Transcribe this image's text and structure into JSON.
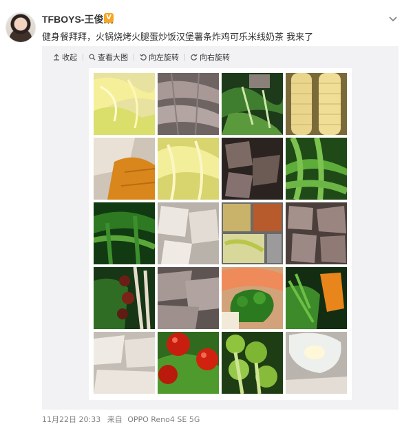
{
  "post": {
    "username": "TFBOYS-王俊凯",
    "verified_badge": "V",
    "text": "健身餐拜拜，火锅烧烤火腿蛋炒饭汉堡薯条炸鸡可乐米线奶茶 我来了",
    "timestamp": "11月22日 20:33",
    "source_prefix": "来自",
    "source_device": "OPPO Reno4 SE 5G"
  },
  "toolbar": {
    "collapse_label": "收起",
    "view_full_label": "查看大图",
    "rotate_left_label": "向左旋转",
    "rotate_right_label": "向右旋转"
  },
  "icons": {
    "more": "chevron-down-icon",
    "collapse": "arrow-up-icon",
    "view_full": "magnifier-icon",
    "rotate_left": "rotate-left-icon",
    "rotate_right": "rotate-right-icon"
  },
  "colors": {
    "badge": "#f6a623",
    "media_bg": "#f2f2f5",
    "footer_text": "#808080"
  },
  "photo_grid": {
    "rows": 5,
    "cols": 4,
    "tiles": [
      "napa-cabbage",
      "sliced-meat",
      "leafy-greens",
      "corn-cob",
      "chicken-and-pumpkin",
      "napa-cabbage",
      "braised-beef",
      "snow-peas",
      "choy-sum",
      "chicken-breast",
      "lunchbox-tray",
      "beef-chunks",
      "spinach-and-dates",
      "sliced-pork",
      "shrimp-and-broccoli",
      "greens-and-pumpkin",
      "chicken-slices",
      "tomato-salad",
      "broccoli",
      "yogurt-and-chicken"
    ]
  }
}
